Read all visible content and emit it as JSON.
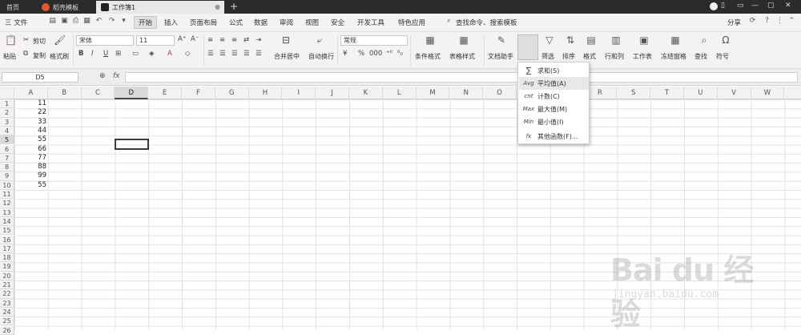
{
  "tabs": [
    {
      "label": "首页"
    },
    {
      "label": "稻壳模板"
    },
    {
      "label": "工作簿1"
    }
  ],
  "window": {
    "new_tab": "+"
  },
  "menubar": {
    "file_label": "三 文件",
    "items": [
      "开始",
      "插入",
      "页面布局",
      "公式",
      "数据",
      "审阅",
      "视图",
      "安全",
      "开发工具",
      "特色应用"
    ],
    "search_label": "查找命令、搜索模板",
    "share_label": "分享"
  },
  "ribbon": {
    "paste": "粘贴",
    "cut": "剪切",
    "copy": "复制",
    "format_painter": "格式刷",
    "font_name": "宋体",
    "font_size": "11",
    "merge_center": "合并居中",
    "wrap_text": "自动换行",
    "number_format": "常规",
    "conditional_format": "条件格式",
    "table_style": "表格样式",
    "doc_assistant": "文档助手",
    "sum": "求和",
    "filter": "筛选",
    "sort": "排序",
    "format": "格式",
    "row_col": "行和列",
    "worksheet": "工作表",
    "freeze": "冻结窗格",
    "find": "查找",
    "symbol": "符号"
  },
  "formula_bar": {
    "name_box": "D5",
    "fx": "fx"
  },
  "grid": {
    "columns": [
      "A",
      "B",
      "C",
      "D",
      "E",
      "F",
      "G",
      "H",
      "I",
      "J",
      "K",
      "L",
      "M",
      "N",
      "O",
      "P",
      "Q",
      "R",
      "S",
      "T",
      "U",
      "V",
      "W"
    ],
    "rows": [
      "1",
      "2",
      "3",
      "4",
      "5",
      "6",
      "7",
      "8",
      "9",
      "10",
      "11",
      "12",
      "13",
      "14",
      "15",
      "16",
      "17",
      "18",
      "19",
      "20",
      "21",
      "22",
      "23",
      "24",
      "25",
      "26"
    ],
    "column_a_values": [
      "11",
      "22",
      "33",
      "44",
      "55",
      "66",
      "77",
      "88",
      "99",
      "55"
    ],
    "selected_cell": "D5"
  },
  "sum_dropdown": {
    "items": [
      {
        "icon": "∑",
        "label": "求和(S)"
      },
      {
        "icon": "Avg",
        "label": "平均值(A)"
      },
      {
        "icon": "cnt",
        "label": "计数(C)"
      },
      {
        "icon": "Max",
        "label": "最大值(M)"
      },
      {
        "icon": "Min",
        "label": "最小值(I)"
      },
      {
        "icon": "fx",
        "label": "其他函数(F)..."
      }
    ]
  },
  "watermark": {
    "logo": "Bai du 经验",
    "url": "jingyan.baidu.com"
  }
}
